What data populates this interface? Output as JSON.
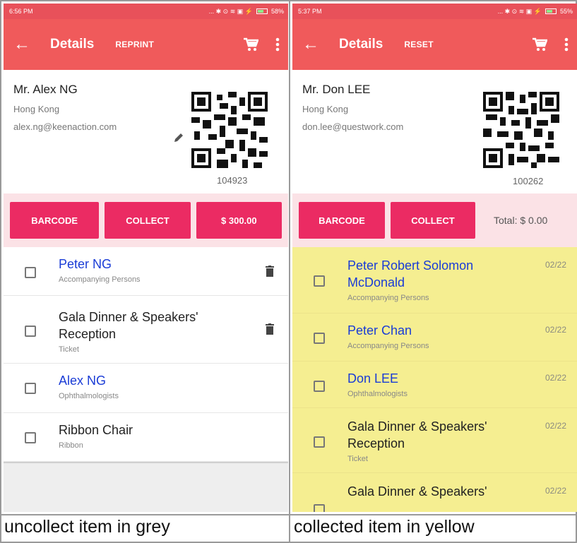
{
  "left": {
    "status": {
      "time": "6:56 PM",
      "icons": "... ✱ ⊙ ≋ ▣ ⚡",
      "battery": "58%"
    },
    "appbar": {
      "title": "Details",
      "action": "REPRINT"
    },
    "profile": {
      "name": "Mr. Alex NG",
      "city": "Hong Kong",
      "email": "alex.ng@keenaction.com",
      "code": "104923"
    },
    "buttons": {
      "barcode": "BARCODE",
      "collect": "COLLECT",
      "amount": "$ 300.00"
    },
    "items": [
      {
        "title": "Peter NG",
        "subtitle": "Accompanying Persons"
      },
      {
        "title": "Gala Dinner & Speakers' Reception",
        "subtitle": "Ticket"
      },
      {
        "title": "Alex NG",
        "subtitle": "Ophthalmologists"
      },
      {
        "title": "Ribbon Chair",
        "subtitle": "Ribbon"
      }
    ],
    "caption": "uncollect item in grey"
  },
  "right": {
    "status": {
      "time": "5:37 PM",
      "icons": "... ✱ ⊙ ≋ ▣ ⚡",
      "battery": "55%"
    },
    "appbar": {
      "title": "Details",
      "action": "RESET"
    },
    "profile": {
      "name": "Mr. Don LEE",
      "city": "Hong Kong",
      "email": "don.lee@questwork.com",
      "code": "100262"
    },
    "buttons": {
      "barcode": "BARCODE",
      "collect": "COLLECT",
      "total": "Total: $ 0.00"
    },
    "items": [
      {
        "title": "Peter Robert Solomon McDonald",
        "subtitle": "Accompanying Persons",
        "date": "02/22"
      },
      {
        "title": "Peter Chan",
        "subtitle": "Accompanying Persons",
        "date": "02/22"
      },
      {
        "title": "Don LEE",
        "subtitle": "Ophthalmologists",
        "date": "02/22"
      },
      {
        "title": "Gala Dinner & Speakers' Reception",
        "subtitle": "Ticket",
        "date": "02/22"
      },
      {
        "title": "Gala Dinner & Speakers'",
        "subtitle": "",
        "date": "02/22"
      }
    ],
    "caption": "collected item in yellow"
  },
  "colors": {
    "appbar": "#f05a5b",
    "button": "#eb2b63",
    "buttonbar": "#fbe2e6",
    "collected": "#f5ee91",
    "link": "#1a3cd6"
  },
  "icons": [
    "back-arrow-icon",
    "cart-icon",
    "more-vert-icon",
    "edit-pencil-icon",
    "qr-code",
    "trash-icon",
    "checkbox-icon"
  ]
}
